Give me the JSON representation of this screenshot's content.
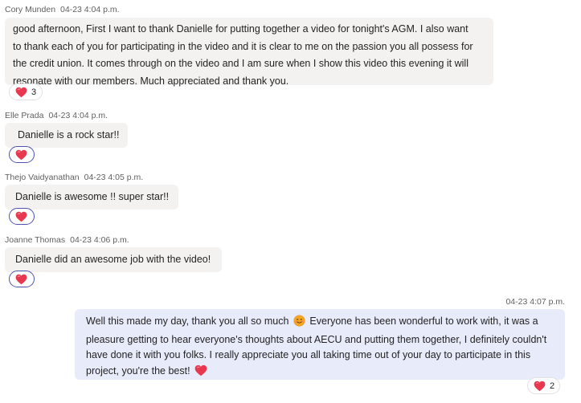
{
  "messages": [
    {
      "author": "Cory Munden",
      "timestamp": "04-23 4:04 p.m.",
      "lines": [
        "good afternoon, First I want to thank Danielle for putting together a video for tonight's AGM. I also want",
        "to thank each of you for participating in the video and it is clear to me on the passion you all possess for",
        "the credit union. It comes through on the video and I am sure when I show this video this evening it will",
        "resonate with our members. Much appreciated and thank you."
      ],
      "reaction": {
        "icon": "heart-icon",
        "count": "3"
      }
    },
    {
      "author": "Elle Prada",
      "timestamp": "04-23 4:04 p.m.",
      "text": "Danielle is a rock star!!",
      "reaction": {
        "icon": "heart-icon"
      }
    },
    {
      "author": "Thejo Vaidyanathan",
      "timestamp": "04-23 4:05 p.m.",
      "text": "Danielle is awesome !! super star!!",
      "reaction": {
        "icon": "heart-icon"
      }
    },
    {
      "author": "Joanne Thomas",
      "timestamp": "04-23 4:06 p.m.",
      "text": "Danielle did an awesome job with the video!",
      "reaction": {
        "icon": "heart-icon"
      }
    }
  ],
  "my_message": {
    "timestamp": "04-23 4:07 p.m.",
    "line1_before_emoji": "Well this made my day, thank you all so much",
    "line1_after_emoji": "Everyone has been wonderful to work with, it was a",
    "line2": "pleasure getting to hear everyone's thoughts about AECU and putting them together, I definitely couldn't",
    "line3": "have done it with you folks. I really appreciate you all taking time out of your day to participate in this",
    "line4": "project, you're the best!",
    "emojis": [
      "smiling-face-icon",
      "heart-icon"
    ],
    "reaction": {
      "icon": "heart-icon",
      "count": "2"
    }
  },
  "colors": {
    "heart": "#e8384f",
    "selected_reaction_border": "#4f52b2",
    "my_bubble": "#e8ebfa",
    "other_bubble": "#f3f2f1"
  }
}
